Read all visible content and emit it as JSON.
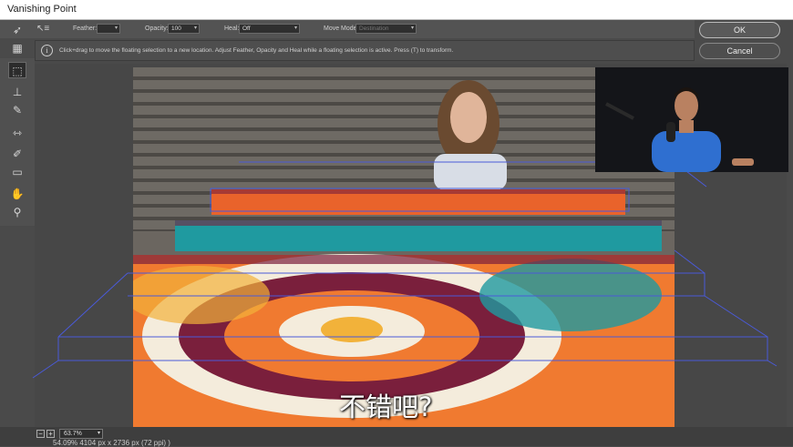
{
  "window": {
    "title": "Vanishing Point"
  },
  "options": {
    "feather_label": "Feather:",
    "feather_value": "",
    "opacity_label": "Opacity:",
    "opacity_value": "100",
    "heal_label": "Heal:",
    "heal_value": "Off",
    "move_mode_label": "Move Mode:",
    "move_mode_value": "Destination"
  },
  "info": {
    "message": "Click+drag to move the floating selection to a new location. Adjust Feather, Opacity and Heal while a floating selection is active. Press (T) to transform."
  },
  "buttons": {
    "ok": "OK",
    "cancel": "Cancel"
  },
  "tools": [
    {
      "name": "edit-plane-tool",
      "icon": "arrow-icon"
    },
    {
      "name": "create-plane-tool",
      "icon": "grid-icon"
    },
    {
      "name": "marquee-tool",
      "icon": "marquee-icon",
      "active": true
    },
    {
      "name": "stamp-tool",
      "icon": "stamp-icon"
    },
    {
      "name": "brush-tool",
      "icon": "brush-icon"
    },
    {
      "name": "transform-tool",
      "icon": "transform-icon"
    },
    {
      "name": "eyedropper-tool",
      "icon": "eyedropper-icon"
    },
    {
      "name": "measure-tool",
      "icon": "ruler-icon"
    },
    {
      "name": "hand-tool",
      "icon": "hand-icon"
    },
    {
      "name": "zoom-tool",
      "icon": "zoom-icon"
    }
  ],
  "zoom": {
    "value": "63.7%"
  },
  "status": {
    "text": "54.09%    4104 px x 2736 px (72 ppi)    )"
  },
  "subtitle": {
    "text": "不错吧?"
  }
}
